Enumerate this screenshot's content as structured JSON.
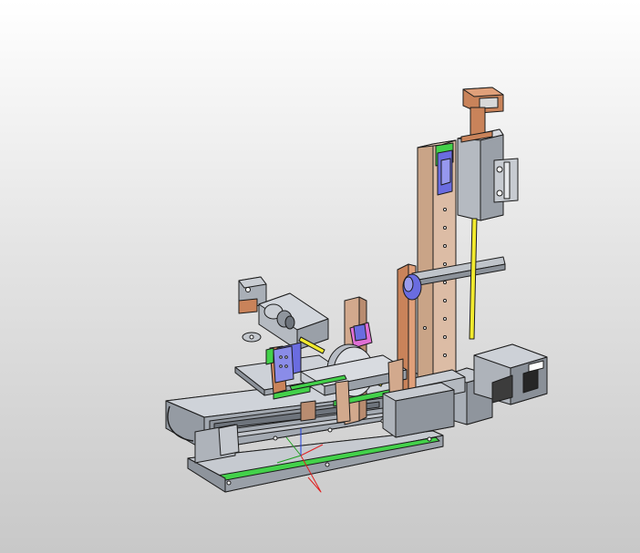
{
  "app": {
    "view": "cad-3d-viewport",
    "model_text": ""
  },
  "colors": {
    "background_top": "#ffffff",
    "background_bottom": "#c8c8c8",
    "steel": "#b7bcc4",
    "steel_dark": "#8a9098",
    "steel_light": "#d2d6dc",
    "outline": "#1c1c1c",
    "copper": "#c9835a",
    "copper_light": "#e0a07a",
    "tan_column": "#d7b49c",
    "green": "#43d14a",
    "blue_violet": "#6a6ce0",
    "pink": "#e070d6",
    "yellow": "#f2ea2e",
    "axis_x": "#e02020",
    "axis_y": "#20a020",
    "axis_z": "#2040e0"
  },
  "icons": {
    "triad": "coordinate-triad-icon"
  }
}
